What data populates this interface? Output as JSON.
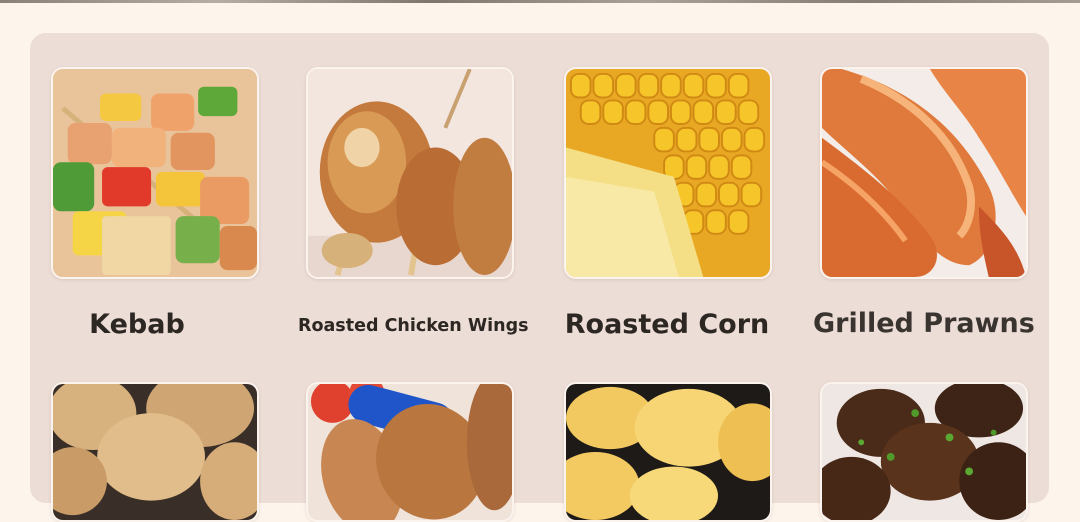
{
  "items": [
    {
      "label": "Kebab"
    },
    {
      "label": "Roasted Chicken Wings"
    },
    {
      "label": "Roasted Corn"
    },
    {
      "label": "Grilled Prawns"
    },
    {
      "label": ""
    },
    {
      "label": ""
    },
    {
      "label": ""
    },
    {
      "label": ""
    }
  ],
  "colors": {
    "page_background": "#fdf4ec",
    "panel_background": "#ecddd6",
    "label_text": "#2d2723"
  },
  "images": [
    "kebab-photo",
    "chicken-wings-photo",
    "corn-photo",
    "prawns-photo",
    "potatoes-photo",
    "sausages-photo",
    "roasted-potato-chunks-photo",
    "mushrooms-photo"
  ]
}
